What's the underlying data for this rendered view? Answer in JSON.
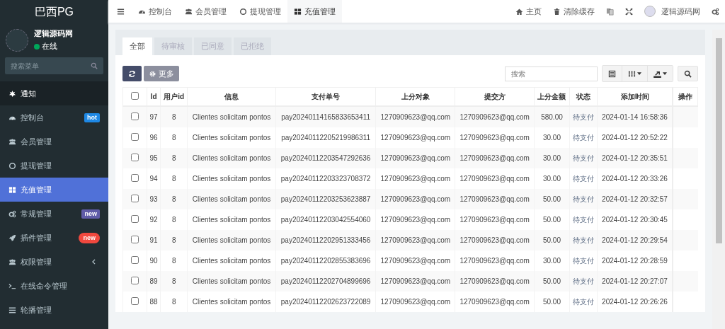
{
  "sidebar": {
    "brand": "巴西PG",
    "user": {
      "name": "逻辑源码网",
      "status": "在线",
      "online": true
    },
    "search": {
      "placeholder": "搜索菜单"
    },
    "items": [
      {
        "label": "通知",
        "selected": false,
        "header": true
      },
      {
        "label": "控制台",
        "selected": false,
        "badge": {
          "text": "hot",
          "color": "#1e88e5",
          "kind": "tag"
        }
      },
      {
        "label": "会员管理",
        "selected": false
      },
      {
        "label": "提现管理",
        "selected": false
      },
      {
        "label": "充值管理",
        "selected": true
      },
      {
        "label": "常规管理",
        "selected": false,
        "badge": {
          "text": "new",
          "color": "#605ca8",
          "kind": "tag"
        }
      },
      {
        "label": "插件管理",
        "selected": false,
        "badge": {
          "text": "new",
          "color": "#f0483e",
          "kind": "pill"
        }
      },
      {
        "label": "权限管理",
        "selected": false,
        "expandable": true
      },
      {
        "label": "在线命令管理",
        "selected": false
      },
      {
        "label": "轮播管理",
        "selected": false
      }
    ]
  },
  "header": {
    "tabs": [
      {
        "label": "控制台",
        "selected": false
      },
      {
        "label": "会员管理",
        "selected": false
      },
      {
        "label": "提现管理",
        "selected": false
      },
      {
        "label": "充值管理",
        "selected": true
      }
    ],
    "links": [
      {
        "label": "主页"
      },
      {
        "label": "清除缓存"
      }
    ],
    "user": {
      "name": "逻辑源码网"
    }
  },
  "filter_tabs": [
    {
      "label": "全部",
      "selected": true
    },
    {
      "label": "待审核",
      "selected": false
    },
    {
      "label": "已同意",
      "selected": false
    },
    {
      "label": "已拒绝",
      "selected": false
    }
  ],
  "toolbar": {
    "more_button": "更多",
    "search": {
      "placeholder": "搜索"
    }
  },
  "table": {
    "select_all_checked": false,
    "columns": [
      "Id",
      "用户id",
      "信息",
      "支付单号",
      "上分对象",
      "提交方",
      "上分金额",
      "状态",
      "添加时间",
      "操作"
    ],
    "rows": [
      {
        "checked": false,
        "cells": [
          "97",
          "8",
          "Clientes solicitam pontos",
          "pay20240114165833653411",
          "1270909623@qq.com",
          "1270909623@qq.com",
          "580.00",
          "待支付",
          "2024-01-14 16:58:36",
          ""
        ]
      },
      {
        "checked": false,
        "cells": [
          "96",
          "8",
          "Clientes solicitam pontos",
          "pay20240112205219986311",
          "1270909623@qq.com",
          "1270909623@qq.com",
          "30.00",
          "待支付",
          "2024-01-12 20:52:22",
          ""
        ]
      },
      {
        "checked": false,
        "cells": [
          "95",
          "8",
          "Clientes solicitam pontos",
          "pay20240112203547292636",
          "1270909623@qq.com",
          "1270909623@qq.com",
          "30.00",
          "待支付",
          "2024-01-12 20:35:51",
          ""
        ]
      },
      {
        "checked": false,
        "cells": [
          "94",
          "8",
          "Clientes solicitam pontos",
          "pay20240112203323708372",
          "1270909623@qq.com",
          "1270909623@qq.com",
          "30.00",
          "待支付",
          "2024-01-12 20:33:26",
          ""
        ]
      },
      {
        "checked": false,
        "cells": [
          "93",
          "8",
          "Clientes solicitam pontos",
          "pay20240112203253623887",
          "1270909623@qq.com",
          "1270909623@qq.com",
          "50.00",
          "待支付",
          "2024-01-12 20:32:57",
          ""
        ]
      },
      {
        "checked": false,
        "cells": [
          "92",
          "8",
          "Clientes solicitam pontos",
          "pay20240112203042554060",
          "1270909623@qq.com",
          "1270909623@qq.com",
          "50.00",
          "待支付",
          "2024-01-12 20:30:45",
          ""
        ]
      },
      {
        "checked": false,
        "cells": [
          "91",
          "8",
          "Clientes solicitam pontos",
          "pay20240112202951333456",
          "1270909623@qq.com",
          "1270909623@qq.com",
          "50.00",
          "待支付",
          "2024-01-12 20:29:54",
          ""
        ]
      },
      {
        "checked": false,
        "cells": [
          "90",
          "8",
          "Clientes solicitam pontos",
          "pay20240112202855383696",
          "1270909623@qq.com",
          "1270909623@qq.com",
          "30.00",
          "待支付",
          "2024-01-12 20:28:59",
          ""
        ]
      },
      {
        "checked": false,
        "cells": [
          "89",
          "8",
          "Clientes solicitam pontos",
          "pay20240112202704899696",
          "1270909623@qq.com",
          "1270909623@qq.com",
          "50.00",
          "待支付",
          "2024-01-12 20:27:07",
          ""
        ]
      },
      {
        "checked": false,
        "cells": [
          "88",
          "8",
          "Clientes solicitam pontos",
          "pay20240112202623722089",
          "1270909623@qq.com",
          "1270909623@qq.com",
          "50.00",
          "待支付",
          "2024-01-12 20:26:26",
          ""
        ]
      }
    ]
  }
}
